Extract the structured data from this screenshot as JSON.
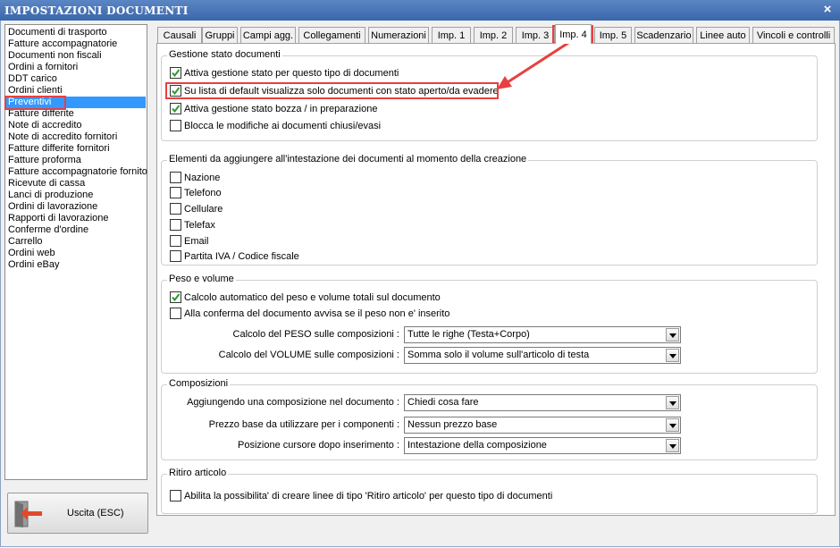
{
  "window": {
    "title": "IMPOSTAZIONI DOCUMENTI",
    "close_glyph": "×"
  },
  "sidebar": {
    "selected_index": 7,
    "items": [
      "Documenti di trasporto",
      "Fatture accompagnatorie",
      "Documenti non fiscali",
      "Ordini a fornitori",
      "DDT carico",
      "Ordini clienti",
      "Preventivi",
      "Fatture differite",
      "Note di accredito",
      "Note di accredito fornitori",
      "Fatture differite fornitori",
      "Fatture proforma",
      "Fatture accompagnatorie fornito",
      "Ricevute di cassa",
      "Lanci di produzione",
      "Ordini di lavorazione",
      "Rapporti di lavorazione",
      "Conferme d'ordine",
      "Carrello",
      "Ordini web",
      "Ordini eBay"
    ]
  },
  "exit_button": {
    "label": "Uscita (ESC)",
    "icon": "exit-door-icon"
  },
  "tabs": [
    "Causali",
    "Gruppi",
    "Campi agg.",
    "Collegamenti",
    "Numerazioni",
    "Imp. 1",
    "Imp. 2",
    "Imp. 3",
    "Imp. 4",
    "Imp. 5",
    "Scadenzario",
    "Linee auto",
    "Vincoli e controlli"
  ],
  "active_tab": "Imp. 4",
  "stato": {
    "title": "Gestione stato documenti",
    "options": [
      {
        "label": "Attiva gestione stato per questo tipo di documenti",
        "checked": true
      },
      {
        "label": "Su lista di default visualizza solo documenti con stato aperto/da evadere",
        "checked": true
      },
      {
        "label": "Attiva gestione stato bozza / in preparazione",
        "checked": true
      },
      {
        "label": "Blocca le modifiche ai documenti chiusi/evasi",
        "checked": false
      }
    ]
  },
  "intestazione": {
    "title": "Elementi da aggiungere all'intestazione dei documenti al momento della creazione",
    "options": [
      {
        "label": "Nazione",
        "checked": false
      },
      {
        "label": "Telefono",
        "checked": false
      },
      {
        "label": "Cellulare",
        "checked": false
      },
      {
        "label": "Telefax",
        "checked": false
      },
      {
        "label": "Email",
        "checked": false
      },
      {
        "label": "Partita IVA / Codice fiscale",
        "checked": false
      }
    ]
  },
  "peso": {
    "title": "Peso e volume",
    "options": [
      {
        "label": "Calcolo automatico del peso e volume totali sul documento",
        "checked": true
      },
      {
        "label": "Alla conferma del documento avvisa se il peso non e' inserito",
        "checked": false
      }
    ],
    "fields": [
      {
        "label": "Calcolo del PESO sulle composizioni :",
        "value": "Tutte le righe (Testa+Corpo)"
      },
      {
        "label": "Calcolo del VOLUME sulle composizioni :",
        "value": "Somma solo il volume sull'articolo di testa"
      }
    ]
  },
  "composizioni": {
    "title": "Composizioni",
    "fields": [
      {
        "label": "Aggiungendo una composizione nel documento :",
        "value": "Chiedi cosa fare"
      },
      {
        "label": "Prezzo base da utilizzare per i componenti :",
        "value": "Nessun prezzo base"
      },
      {
        "label": "Posizione cursore dopo inserimento :",
        "value": "Intestazione della composizione"
      }
    ]
  },
  "ritiro": {
    "title": "Ritiro articolo",
    "options": [
      {
        "label": "Abilita la possibilita' di creare linee di tipo 'Ritiro articolo' per questo tipo di documenti",
        "checked": false
      }
    ]
  },
  "colors": {
    "titlebar": "#3a67ab",
    "selection": "#3399ff",
    "highlight": "#e84040",
    "checkmark": "#2a9a2a"
  }
}
